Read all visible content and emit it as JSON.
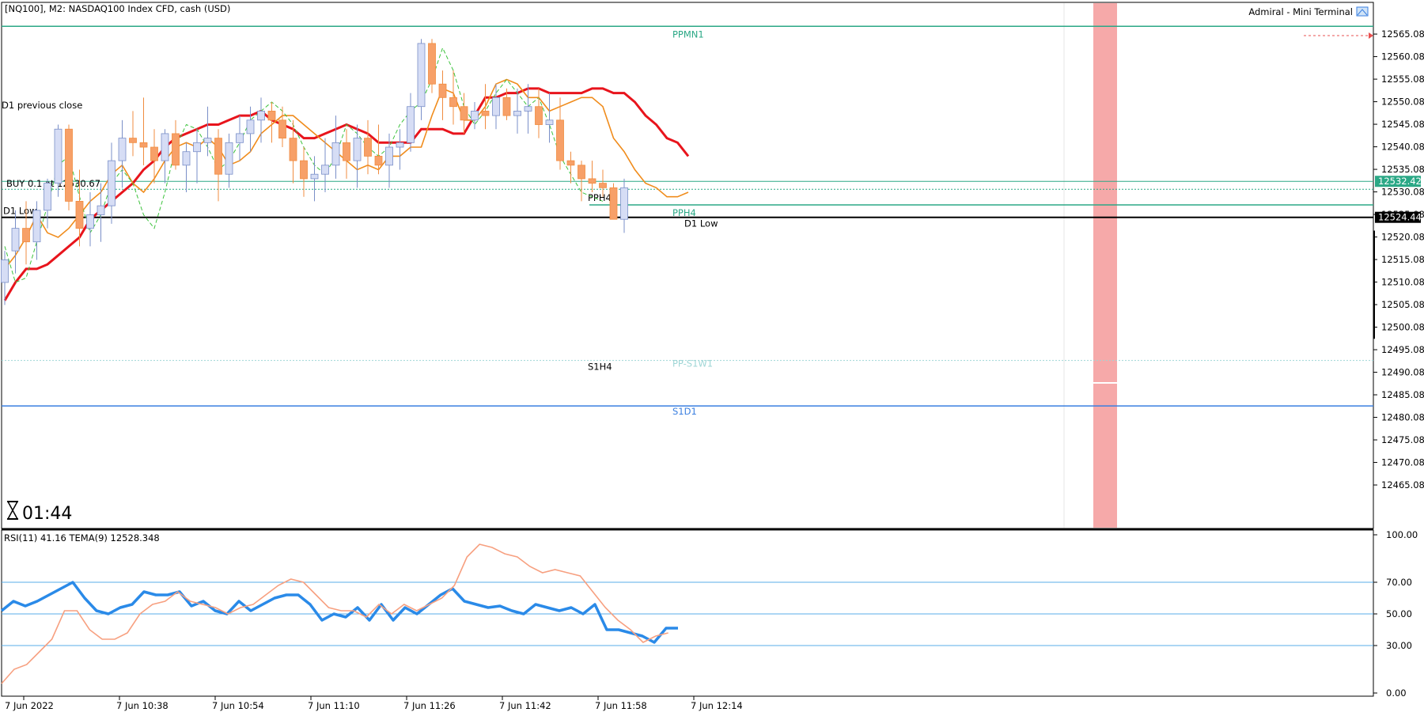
{
  "header": {
    "symbol_title": "[NQ100], M2:  NASDAQ100 Index CFD, cash (USD)",
    "terminal_label": "Admiral - Mini Terminal"
  },
  "timer": {
    "value": "01:44"
  },
  "indicator_header": "RSI(11) 41.16 TEMA(9) 12528.348",
  "colors": {
    "bull_candle": "#d6ddf5",
    "bear_candle": "#f7a068",
    "ma_slow": "#e8141c",
    "ma_fast": "#f08c1c",
    "ma_dashed": "#3cc23c",
    "pp_line": "#2ba886",
    "s1d1_line": "#3a7fe0",
    "rsi_line": "#2a8ae8",
    "tema_line": "#f7a080",
    "highlight_zone": "#f59a9a",
    "price_tag": "#2ba886"
  },
  "chart_data": {
    "type": "candlestick",
    "price_axis": {
      "ylim": [
        12460.7,
        12567.9
      ],
      "ticks": [
        "12565.08",
        "12560.08",
        "12555.08",
        "12550.08",
        "12545.08",
        "12540.08",
        "12535.08",
        "12530.08",
        "12525.08",
        "12520.08",
        "12515.08",
        "12510.08",
        "12505.08",
        "12500.08",
        "12495.08",
        "12490.08",
        "12485.08",
        "12480.08",
        "12475.08",
        "12470.08",
        "12465.08"
      ]
    },
    "time_axis": {
      "ticks": [
        "7 Jun 2022",
        "7 Jun 10:38",
        "7 Jun 10:54",
        "7 Jun 11:10",
        "7 Jun 11:26",
        "7 Jun 11:42",
        "7 Jun 11:58",
        "7 Jun 12:14"
      ]
    },
    "current_price": "12532.42",
    "bid_price": "12524.44",
    "levels": [
      {
        "label": "PPMN1",
        "price": 12566.8,
        "style": "solid",
        "color": "#2ba886"
      },
      {
        "label": "D1 previous close",
        "price": 12532.42,
        "style": "solid",
        "color": "#2ba886"
      },
      {
        "label": "BUY 0.1 at 12530.67",
        "price": 12530.67,
        "style": "dotted",
        "color": "#2ba886"
      },
      {
        "label": "PPH4",
        "price": 12527.2,
        "style": "solid",
        "color": "#2ba886"
      },
      {
        "label": "D1 Low",
        "price": 12524.44,
        "style": "solid",
        "color": "#000000"
      },
      {
        "label": "S1H4",
        "price": 12492.7,
        "style": "dotted",
        "color": "#9fd6d6"
      },
      {
        "label": "PP-S1W1",
        "price": 12492.7,
        "style": "dotted",
        "color": "#9fd6d6"
      },
      {
        "label": "S1D1",
        "price": 12482.6,
        "style": "solid",
        "color": "#3a7fe0"
      }
    ],
    "candles": [
      [
        12510,
        12517,
        12505,
        12515
      ],
      [
        12517,
        12526,
        12512,
        12522
      ],
      [
        12522,
        12528,
        12514,
        12519
      ],
      [
        12519,
        12528,
        12515,
        12526
      ],
      [
        12526,
        12533,
        12522,
        12532
      ],
      [
        12532,
        12545,
        12529,
        12544
      ],
      [
        12544,
        12545,
        12526,
        12528
      ],
      [
        12528,
        12535,
        12518,
        12522
      ],
      [
        12522,
        12530,
        12518,
        12525
      ],
      [
        12525,
        12532,
        12519,
        12527
      ],
      [
        12527,
        12541,
        12523,
        12537
      ],
      [
        12537,
        12546,
        12531,
        12542
      ],
      [
        12542,
        12548,
        12538,
        12541
      ],
      [
        12541,
        12551,
        12536,
        12540
      ],
      [
        12540,
        12544,
        12532,
        12537
      ],
      [
        12537,
        12544,
        12532,
        12543
      ],
      [
        12543,
        12546,
        12535,
        12536
      ],
      [
        12536,
        12541,
        12530,
        12539
      ],
      [
        12539,
        12544,
        12532,
        12541
      ],
      [
        12541,
        12549,
        12538,
        12542
      ],
      [
        12542,
        12544,
        12528,
        12534
      ],
      [
        12534,
        12543,
        12531,
        12541
      ],
      [
        12541,
        12547,
        12537,
        12543
      ],
      [
        12543,
        12549,
        12539,
        12546
      ],
      [
        12546,
        12551,
        12541,
        12548
      ],
      [
        12548,
        12550,
        12541,
        12546
      ],
      [
        12546,
        12549,
        12540,
        12542
      ],
      [
        12542,
        12546,
        12532,
        12537
      ],
      [
        12537,
        12540,
        12529,
        12533
      ],
      [
        12533,
        12538,
        12528,
        12534
      ],
      [
        12534,
        12542,
        12530,
        12536
      ],
      [
        12536,
        12547,
        12533,
        12541
      ],
      [
        12541,
        12544,
        12533,
        12537
      ],
      [
        12537,
        12545,
        12531,
        12542
      ],
      [
        12542,
        12546,
        12534,
        12538
      ],
      [
        12538,
        12545,
        12534,
        12536
      ],
      [
        12536,
        12543,
        12531,
        12540
      ],
      [
        12540,
        12544,
        12535,
        12541
      ],
      [
        12541,
        12552,
        12539,
        12549
      ],
      [
        12549,
        12564,
        12546,
        12563
      ],
      [
        12563,
        12564,
        12552,
        12554
      ],
      [
        12554,
        12557,
        12546,
        12551
      ],
      [
        12551,
        12557,
        12545,
        12549
      ],
      [
        12549,
        12552,
        12543,
        12546
      ],
      [
        12546,
        12550,
        12544,
        12548
      ],
      [
        12548,
        12554,
        12544,
        12547
      ],
      [
        12547,
        12554,
        12544,
        12551
      ],
      [
        12551,
        12553,
        12546,
        12547
      ],
      [
        12547,
        12553,
        12543,
        12548
      ],
      [
        12548,
        12554,
        12543,
        12549
      ],
      [
        12549,
        12553,
        12542,
        12545
      ],
      [
        12545,
        12552,
        12541,
        12546
      ],
      [
        12546,
        12551,
        12535,
        12537
      ],
      [
        12537,
        12539,
        12532,
        12536
      ],
      [
        12536,
        12537,
        12528,
        12533
      ],
      [
        12533,
        12537,
        12530,
        12532
      ],
      [
        12532,
        12535,
        12529,
        12531
      ],
      [
        12531,
        12532,
        12524,
        12524
      ],
      [
        12524,
        12533,
        12521,
        12531
      ]
    ],
    "series": [
      {
        "name": "",
        "style": "thick",
        "values": [
          12506,
          12510,
          12513,
          12513,
          12514,
          12516,
          12518,
          12520,
          12524,
          12526,
          12528,
          12530,
          12532,
          12535,
          12537,
          12540,
          12542,
          12543,
          12544,
          12545,
          12545,
          12546,
          12547,
          12547,
          12548,
          12546,
          12545,
          12544,
          12542,
          12542,
          12543,
          12544,
          12545,
          12544,
          12543,
          12541,
          12541,
          12541,
          12541,
          12544,
          12544,
          12544,
          12543,
          12543,
          12547,
          12551,
          12551,
          12552,
          12552,
          12553,
          12553,
          12552,
          12552,
          12552,
          12552,
          12553,
          12553,
          12552,
          12552,
          12550,
          12547,
          12545,
          12542,
          12541,
          12538
        ]
      },
      {
        "name": "",
        "style": "thin",
        "values": [
          12513,
          12516,
          12520,
          12525,
          12521,
          12520,
          12522,
          12525,
          12528,
          12530,
          12534,
          12536,
          12532,
          12530,
          12533,
          12537,
          12540,
          12541,
          12540,
          12542,
          12540,
          12536,
          12537,
          12539,
          12543,
          12545,
          12547,
          12547,
          12545,
          12543,
          12541,
          12539,
          12537,
          12535,
          12536,
          12535,
          12538,
          12538,
          12540,
          12540,
          12547,
          12553,
          12552,
          12546,
          12546,
          12549,
          12554,
          12555,
          12554,
          12551,
          12551,
          12548,
          12549,
          12550,
          12551,
          12551,
          12549,
          12542,
          12539,
          12535,
          12532,
          12531,
          12529,
          12529,
          12530
        ]
      },
      {
        "name": "",
        "style": "dashed",
        "values": [
          12518,
          12510,
          12511,
          12519,
          12527,
          12536,
          12538,
          12529,
          12521,
          12525,
          12532,
          12535,
          12532,
          12525,
          12522,
          12530,
          12540,
          12545,
          12544,
          12540,
          12535,
          12537,
          12541,
          12546,
          12548,
          12550,
          12548,
          12545,
          12540,
          12536,
          12534,
          12538,
          12545,
          12543,
          12540,
          12538,
          12540,
          12545,
          12548,
          12550,
          12555,
          12562,
          12557,
          12549,
          12545,
          12548,
          12552,
          12555,
          12552,
          12549,
          12551,
          12545,
          12538,
          12534,
          12530,
          12529,
          12528
        ]
      }
    ],
    "rsi_panel": {
      "ylim": [
        0,
        100
      ],
      "ticks": [
        "100.00",
        "70.00",
        "50.00",
        "30.00",
        "0.00"
      ],
      "levels": [
        70,
        50,
        30
      ],
      "rsi_values": [
        52,
        58,
        55,
        58,
        62,
        66,
        70,
        60,
        52,
        50,
        54,
        56,
        64,
        62,
        62,
        64,
        55,
        58,
        52,
        50,
        58,
        52,
        56,
        60,
        62,
        62,
        56,
        46,
        50,
        48,
        54,
        46,
        56,
        46,
        54,
        50,
        56,
        62,
        66,
        58,
        56,
        54,
        55,
        52,
        50,
        56,
        54,
        52,
        54,
        50,
        56,
        40,
        40,
        38,
        36,
        32,
        41,
        41
      ],
      "tema_values": [
        6,
        15,
        18,
        26,
        34,
        52,
        52,
        40,
        34,
        34,
        38,
        50,
        56,
        58,
        64,
        58,
        56,
        54,
        50,
        54,
        56,
        62,
        68,
        72,
        70,
        62,
        54,
        52,
        52,
        48,
        56,
        50,
        56,
        52,
        56,
        60,
        68,
        86,
        94,
        92,
        88,
        86,
        80,
        76,
        78,
        76,
        74,
        64,
        54,
        46,
        40,
        32,
        36,
        38
      ]
    }
  }
}
